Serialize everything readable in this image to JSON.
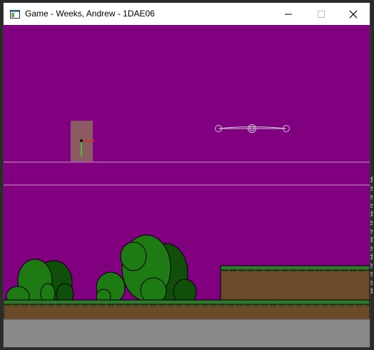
{
  "window": {
    "title": "Game - Weeks, Andrew - 1DAE06",
    "controls": [
      "minimize",
      "maximize",
      "close"
    ]
  },
  "colors": {
    "sky": "#800080",
    "player_box": "#8b5a62",
    "ground_dirt": "#6b4a2a",
    "grass": "#2f7a2f",
    "bush_light": "#1e7a12",
    "bush_dark": "#0f4f0a",
    "stone": "#8a8a8a",
    "guide_line": "#c8a0c8"
  },
  "icons": {
    "app": "window-app-icon",
    "minimize": "minimize-icon",
    "maximize": "maximize-icon",
    "close": "close-icon"
  },
  "background_edge_glyphs": [
    "d",
    "e",
    "e",
    "e",
    "d",
    "e",
    "e",
    "d",
    "e",
    "d",
    "e",
    "e",
    "e",
    "d"
  ]
}
